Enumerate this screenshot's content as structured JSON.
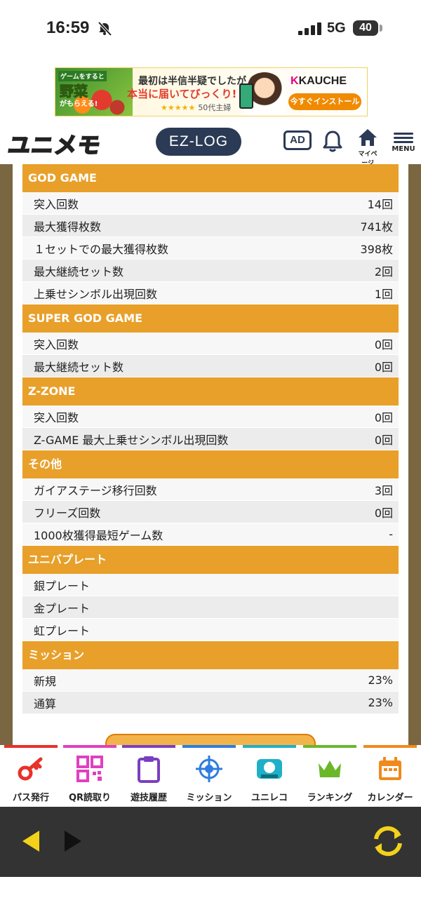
{
  "status_bar": {
    "time": "16:59",
    "network": "5G",
    "battery": "40"
  },
  "ad_banner": {
    "veg_tag": "ゲームをすると",
    "veg_word": "野菜",
    "veg_sub": "がもらえる!",
    "line1": "最初は半信半疑でしたが",
    "line2": "本当に届いてびっくり!",
    "stars": "★★★★★",
    "reviewer": "50代主婦",
    "brand": "KAUCHE",
    "install_label": "今すぐインストール"
  },
  "header": {
    "logo": "ユニメモ",
    "ezlog": "EZ-LOG",
    "ad_label": "AD",
    "home_label": "マイページ",
    "menu_label": "MENU"
  },
  "table": {
    "sections": [
      {
        "title": "GOD GAME",
        "rows": [
          {
            "label": "突入回数",
            "value": "14回"
          },
          {
            "label": "最大獲得枚数",
            "value": "741枚"
          },
          {
            "label": "１セットでの最大獲得枚数",
            "value": "398枚"
          },
          {
            "label": "最大継続セット数",
            "value": "2回"
          },
          {
            "label": "上乗せシンボル出現回数",
            "value": "1回"
          }
        ]
      },
      {
        "title": "SUPER GOD GAME",
        "rows": [
          {
            "label": "突入回数",
            "value": "0回"
          },
          {
            "label": "最大継続セット数",
            "value": "0回"
          }
        ]
      },
      {
        "title": "Z-ZONE",
        "rows": [
          {
            "label": "突入回数",
            "value": "0回"
          },
          {
            "label": "Z-GAME 最大上乗せシンボル出現回数",
            "value": "0回"
          }
        ]
      },
      {
        "title": "その他",
        "rows": [
          {
            "label": "ガイアステージ移行回数",
            "value": "3回"
          },
          {
            "label": "フリーズ回数",
            "value": "0回"
          },
          {
            "label": "1000枚獲得最短ゲーム数",
            "value": "-"
          }
        ]
      },
      {
        "title": "ユニバプレート",
        "rows": [
          {
            "label": "銀プレート",
            "value": ""
          },
          {
            "label": "金プレート",
            "value": ""
          },
          {
            "label": "虹プレート",
            "value": ""
          }
        ]
      },
      {
        "title": "ミッション",
        "rows": [
          {
            "label": "新規",
            "value": "23%"
          },
          {
            "label": "通算",
            "value": "23%"
          }
        ]
      }
    ]
  },
  "tab_bar": {
    "tabs": [
      {
        "label": "パス発行",
        "color": "#e8312a"
      },
      {
        "label": "QR読取り",
        "color": "#e040c0"
      },
      {
        "label": "遊技履歴",
        "color": "#7a3fc0"
      },
      {
        "label": "ミッション",
        "color": "#2e7de0"
      },
      {
        "label": "ユニレコ",
        "color": "#1fb0c8"
      },
      {
        "label": "ランキング",
        "color": "#6ab82a"
      },
      {
        "label": "カレンダー",
        "color": "#f08a1c"
      }
    ]
  },
  "colors": {
    "section": "#e8a02a",
    "frame": "#7a6741",
    "accent": "#ffd400"
  }
}
